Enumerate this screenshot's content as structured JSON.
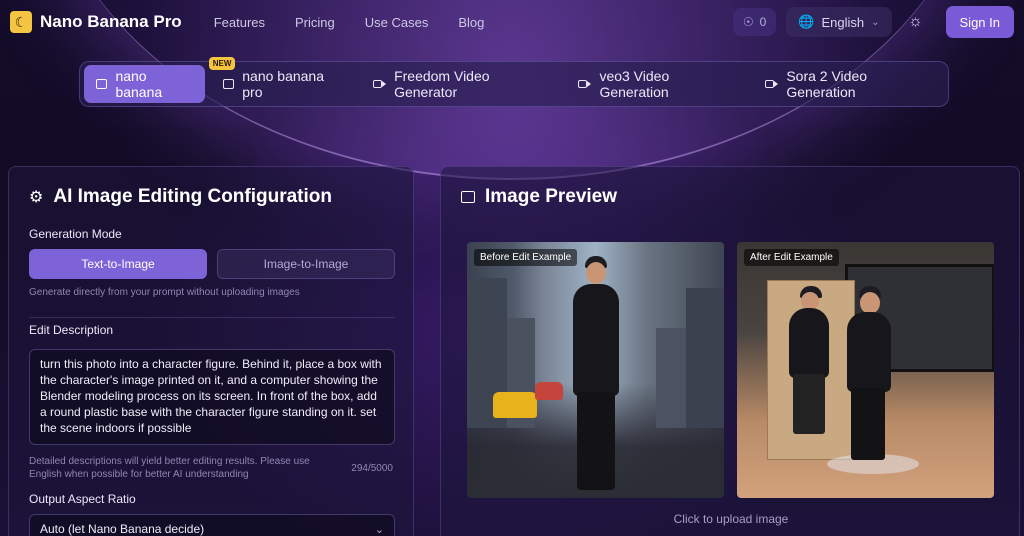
{
  "header": {
    "brand": "Nano Banana Pro",
    "nav": [
      "Features",
      "Pricing",
      "Use Cases",
      "Blog"
    ],
    "credits": "0",
    "language": "English",
    "sign_in": "Sign In"
  },
  "tabs": [
    {
      "label": "nano banana",
      "active": true,
      "icon": "image-icon"
    },
    {
      "label": "nano banana pro",
      "badge": "NEW",
      "icon": "image-icon"
    },
    {
      "label": "Freedom Video Generator",
      "icon": "video-icon"
    },
    {
      "label": "veo3 Video Generation",
      "icon": "video-icon"
    },
    {
      "label": "Sora 2 Video Generation",
      "icon": "video-icon"
    }
  ],
  "config": {
    "title": "AI Image Editing Configuration",
    "generation_mode_label": "Generation Mode",
    "mode_text": "Text-to-Image",
    "mode_image": "Image-to-Image",
    "mode_hint": "Generate directly from your prompt without uploading images",
    "edit_label": "Edit Description",
    "edit_value": "turn this photo into a character figure. Behind it, place a box with the character's image printed on it, and a computer showing the Blender modeling process on its screen. In front of the box, add a round plastic base with the character figure standing on it. set the scene indoors if possible",
    "edit_hint": "Detailed descriptions will yield better editing results. Please use English when possible for better AI understanding",
    "char_count": "294/5000",
    "aspect_label": "Output Aspect Ratio",
    "aspect_value": "Auto (let Nano Banana decide)"
  },
  "preview": {
    "title": "Image Preview",
    "before_tag": "Before Edit Example",
    "after_tag": "After Edit Example",
    "upload_hint": "Click to upload image"
  }
}
